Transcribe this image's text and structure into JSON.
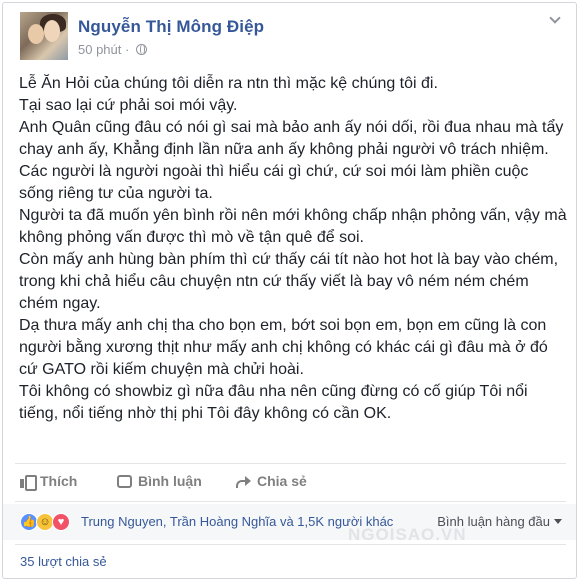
{
  "post": {
    "author": "Nguyễn Thị Mông Điệp",
    "time": "50 phút · ",
    "paragraphs": [
      "Lễ Ăn Hỏi của chúng tôi diễn ra ntn thì mặc kệ chúng tôi đi.",
      "Tại sao lại cứ phải soi mói vậy.",
      "Anh Quân cũng đâu có nói gì sai mà bảo anh ấy nói dối, rồi đua nhau mà tẩy chay anh ấy, Khẳng định lần nữa anh ấy không phải người vô trách nhiệm.",
      "Các người là người ngoài thì hiểu cái gì chứ, cứ soi mói làm phiền cuộc sống riêng tư của người ta.",
      "Người ta đã muốn yên bình rồi nên mới không chấp nhận phỏng vấn, vậy mà không phỏng vấn được thì mò về tận quê để soi.",
      "Còn mấy anh hùng bàn phím thì cứ thấy cái tít nào hot hot là bay vào chém, trong khi chả hiểu câu chuyện ntn cứ thấy viết là bay vô ném ném chém chém ngay.",
      "Dạ thưa mấy anh chị tha cho bọn em, bớt soi bọn em, bọn em cũng là con người bằng xương thịt như mấy anh chị không có khác cái gì đâu mà ở đó cứ GATO rồi kiếm chuyện mà chửi hoài.",
      "Tôi không có showbiz gì nữa đâu nha nên cũng đừng có cố giúp Tôi nổi tiếng, nổi tiếng nhờ thị phi Tôi đây không có cần OK."
    ]
  },
  "actions": {
    "like": "Thích",
    "comment": "Bình luận",
    "share": "Chia sẻ"
  },
  "reactions": {
    "summary": "Trung Nguyen, Trần Hoàng Nghĩa và 1,5K người khác",
    "sort": "Bình luận hàng đầu",
    "icons": [
      "like-icon",
      "haha-icon",
      "love-icon"
    ]
  },
  "shares": "35 lượt chia sẻ",
  "watermark": "NGOISAO.VN",
  "colors": {
    "link": "#365899",
    "muted": "#90949c",
    "text": "#1d2129"
  }
}
